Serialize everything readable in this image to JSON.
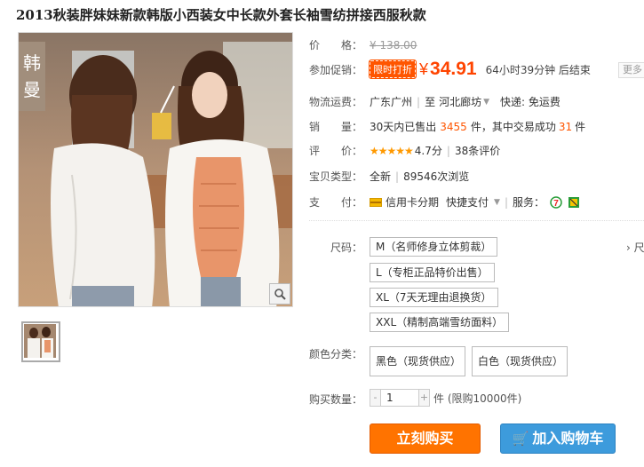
{
  "title": "2013秋装胖妹妹新款韩版小西装女中长款外套长袖雪纺拼接西服秋款",
  "brand_tag": [
    "韩",
    "曼"
  ],
  "price": {
    "label": "价　　格：",
    "original": "¥ 138.00"
  },
  "promo": {
    "label": "参加促销：",
    "badge": "限时打折",
    "currency": "¥",
    "price": "34.91",
    "countdown": "64小时39分钟 后结束",
    "more": "更多"
  },
  "shipping": {
    "label": "物流运费：",
    "from": "广东广州",
    "to_prefix": "至",
    "to": "河北廊坊",
    "express": "快递: 免运费"
  },
  "sales": {
    "label": "销　　量：",
    "prefix": "30天内已售出",
    "sold": "3455",
    "middle": "件，其中交易成功",
    "success": "31",
    "suffix": "件"
  },
  "rating": {
    "label": "评　　价：",
    "stars": "★★★★★",
    "score": "4.7分",
    "reviews": "38条评价"
  },
  "type": {
    "label": "宝贝类型：",
    "value": "全新",
    "views": "89546次浏览"
  },
  "payment": {
    "label": "支　　付：",
    "credit": "信用卡分期",
    "quick": "快捷支付",
    "service_label": "服务："
  },
  "size": {
    "label": "尺码：",
    "options": [
      "M（名师修身立体剪裁）",
      "L（专柜正品特价出售）",
      "XL（7天无理由退换货）",
      "XXL（精制高端雪纺面料）"
    ],
    "side": "› 尺"
  },
  "color": {
    "label": "颜色分类：",
    "options": [
      "黑色（现货供应）",
      "白色（现货供应）"
    ]
  },
  "quantity": {
    "label": "购买数量：",
    "minus": "-",
    "plus": "+",
    "value": "1",
    "note": "件 (限购10000件)"
  },
  "actions": {
    "buy_now": "立刻购买",
    "add_cart": "加入购物车"
  },
  "colors": {
    "accent": "#ff5500",
    "price": "#ff4400",
    "buy": "#ff7300",
    "cart": "#3d9bdc"
  }
}
